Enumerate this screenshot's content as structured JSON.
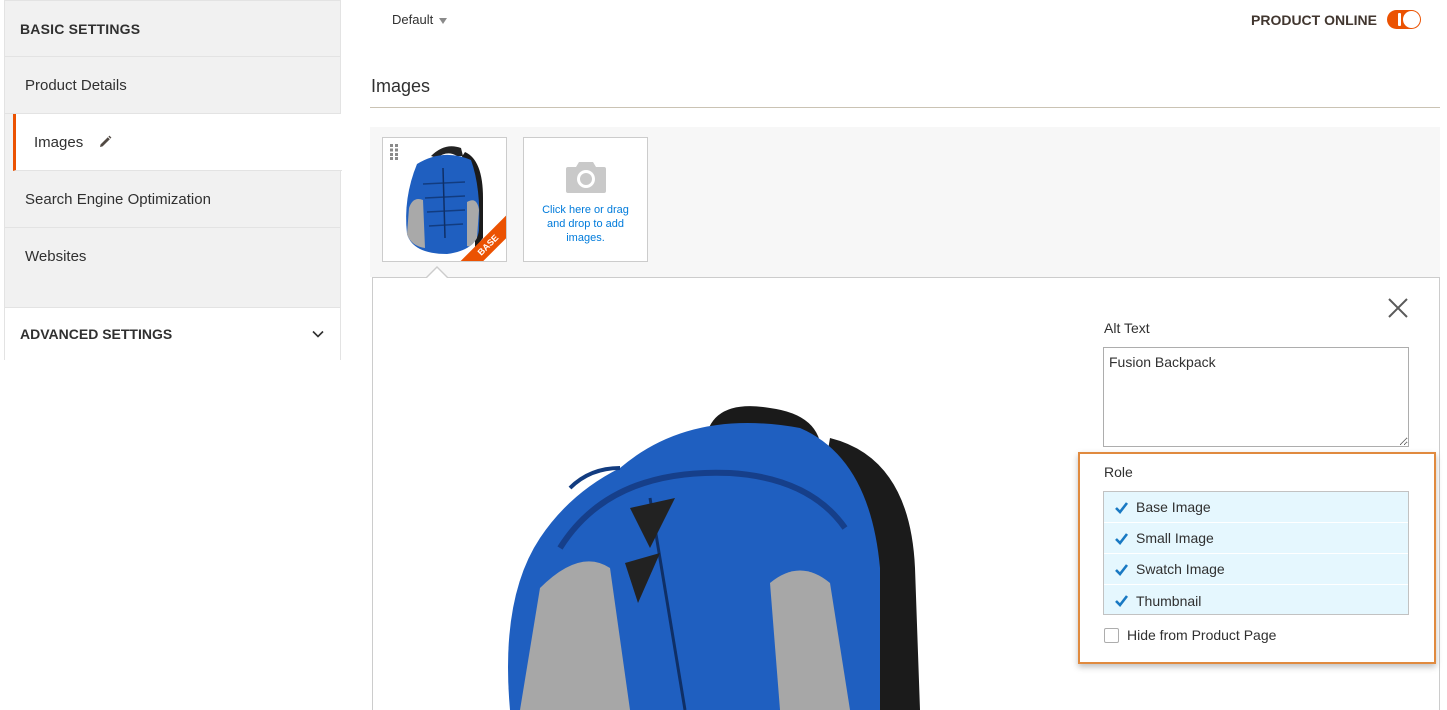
{
  "sidebar": {
    "basic_settings": "BASIC SETTINGS",
    "items": [
      {
        "label": "Product Details"
      },
      {
        "label": "Images"
      },
      {
        "label": "Search Engine Optimization"
      },
      {
        "label": "Websites"
      }
    ],
    "advanced_settings": "ADVANCED SETTINGS"
  },
  "header": {
    "scope": "Default",
    "product_online_label": "PRODUCT ONLINE",
    "product_online": true
  },
  "images_section": {
    "title": "Images",
    "thumbnail_badge": "BASE",
    "upload_text": "Click here or drag and drop to add images."
  },
  "image_detail": {
    "alt_text_label": "Alt Text",
    "alt_text_value": "Fusion Backpack",
    "role_label": "Role",
    "roles": [
      {
        "label": "Base Image",
        "checked": true
      },
      {
        "label": "Small Image",
        "checked": true
      },
      {
        "label": "Swatch Image",
        "checked": true
      },
      {
        "label": "Thumbnail",
        "checked": true
      }
    ],
    "hide_label": "Hide from Product Page",
    "hide_checked": false
  },
  "colors": {
    "accent": "#eb5202",
    "role_bg": "#e5f7fe",
    "check": "#1979c3",
    "backpack_blue": "#1f5fc0"
  }
}
